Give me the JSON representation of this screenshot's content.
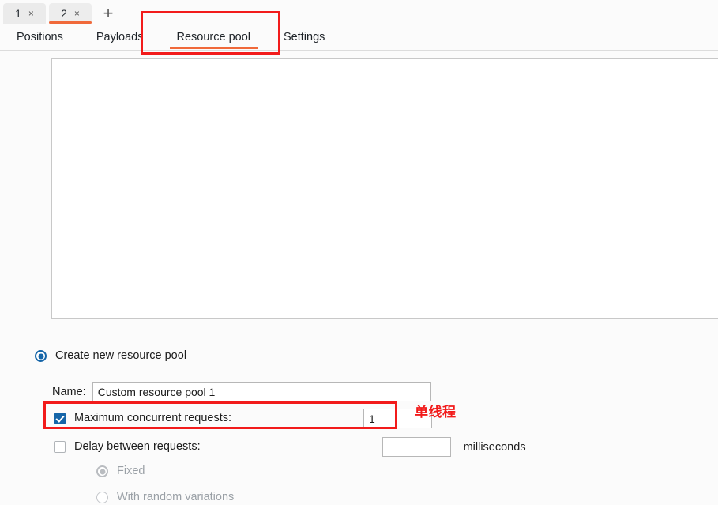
{
  "attack_tabs": {
    "tabs": [
      {
        "label": "1",
        "close": "×",
        "active": false
      },
      {
        "label": "2",
        "close": "×",
        "active": true
      }
    ],
    "add_label": "+"
  },
  "section_tabs": {
    "items": [
      {
        "label": "Positions",
        "active": false
      },
      {
        "label": "Payloads",
        "active": false
      },
      {
        "label": "Resource pool",
        "active": true
      },
      {
        "label": "Settings",
        "active": false
      }
    ]
  },
  "resource_pool": {
    "create_new_label": "Create new resource pool",
    "name_label": "Name:",
    "name_value": "Custom resource pool 1",
    "name_placeholder": "",
    "max_concurrent_label": "Maximum concurrent requests:",
    "max_concurrent_value": "1",
    "max_concurrent_checked": true,
    "delay_label": "Delay between requests:",
    "delay_value": "",
    "delay_checked": false,
    "milliseconds_label": "milliseconds",
    "fixed_label": "Fixed",
    "fixed_selected": true,
    "random_label": "With random variations",
    "random_selected": false
  },
  "annotations": {
    "note_text": "单线程",
    "highlight_color": "#f21b1b",
    "accent_color": "#f0693a",
    "control_accent_color": "#1565a8"
  }
}
